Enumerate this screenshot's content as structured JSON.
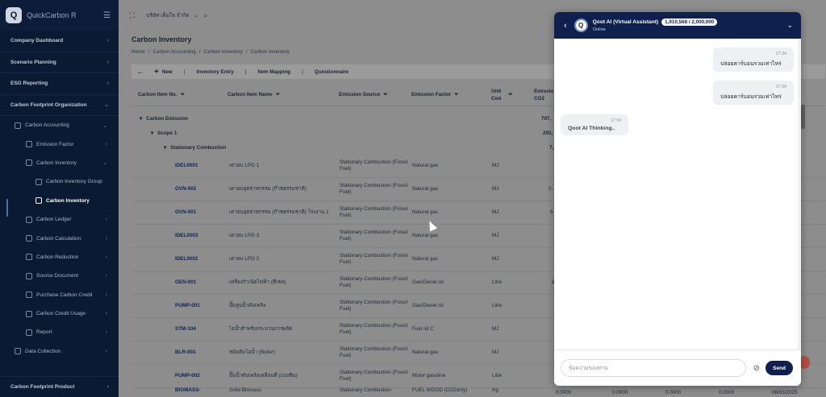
{
  "sidebar": {
    "brand": "QuickCarbon R",
    "logo_letter": "Q",
    "items": [
      {
        "label": "Company Dashboard"
      },
      {
        "label": "Scenario Planning"
      },
      {
        "label": "ESG Reporting"
      },
      {
        "label": "Carbon Footprint Organization"
      }
    ],
    "sub_items": [
      {
        "label": "Carbon Accounting"
      },
      {
        "label": "Emission Factor"
      },
      {
        "label": "Carbon Inventory"
      },
      {
        "label": "Carbon Inventory Group"
      },
      {
        "label": "Carbon Inventory"
      },
      {
        "label": "Carbon Ledger"
      },
      {
        "label": "Carbon Calculation"
      },
      {
        "label": "Carbon Reduction"
      },
      {
        "label": "Source Document"
      },
      {
        "label": "Purchase Carbon Credit"
      },
      {
        "label": "Carbon Credit Usage"
      },
      {
        "label": "Report"
      },
      {
        "label": "Data Collection"
      }
    ],
    "bottom_item": "Carbon Footprint Product"
  },
  "topbar": {
    "company": "บริษัท เต็มใจ จำกัด"
  },
  "page": {
    "title": "Carbon Inventory",
    "breadcrumb": [
      "Home",
      "/",
      "Carbon Accounting",
      "/",
      "Carbon Inventory",
      "/",
      "Carbon Inventory"
    ]
  },
  "toolbar": {
    "new_label": "New",
    "tabs": [
      "Inventory Entry",
      "Item Mapping",
      "Questionnaire"
    ]
  },
  "table": {
    "columns": [
      "Carbon Item No.",
      "Carbon Item Name",
      "Emission Source",
      "Emission Factor",
      "Unit",
      "Cod",
      "Emissio",
      "CO2"
    ],
    "groups": [
      {
        "label": "Carbon Emission",
        "value": "707,"
      },
      {
        "label": "Scope 1",
        "value": "255,"
      },
      {
        "label": "Stationary Combustion",
        "value": "7,"
      }
    ],
    "rows": [
      {
        "code": "IDEL0001",
        "name": "เตาอบ LPG 1",
        "source": "Stationary Combustion (Fossil Fuel)",
        "factor": "Natural gas",
        "unit": "MJ",
        "emission": ""
      },
      {
        "code": "OVN-002",
        "name": "เตาอบอุตสาหกรรม (ก๊าซธรรมชาติ)",
        "source": "Stationary Combustion (Fossil Fuel)",
        "factor": "Natural gas",
        "unit": "MJ",
        "emission": "5."
      },
      {
        "code": "OVN-001",
        "name": "เตาอบอุตสาหกรรม (ก๊าซธรรมชาติ) โรงงาน 1",
        "source": "Stationary Combustion (Fossil Fuel)",
        "factor": "Natural gas",
        "unit": "MJ",
        "emission": "6"
      },
      {
        "code": "IDEL0003",
        "name": "เตาอบ LPG 3",
        "source": "Stationary Combustion (Fossil Fuel)",
        "factor": "Natural gas",
        "unit": "MJ",
        "emission": ""
      },
      {
        "code": "IDEL0002",
        "name": "เตาอบ LPG 2",
        "source": "Stationary Combustion (Fossil Fuel)",
        "factor": "Natural gas",
        "unit": "MJ",
        "emission": ""
      },
      {
        "code": "GEN-001",
        "name": "เครื่องกำเนิดไฟฟ้า (ดีเซล)",
        "source": "Stationary Combustion (Fossil Fuel)",
        "factor": "Gas/Diesel oil",
        "unit": "Litre",
        "emission": "8"
      },
      {
        "code": "PUMP-001",
        "name": "ปั๊มสูบน้ำดับเพลิง",
        "source": "Stationary Combustion (Fossil Fuel)",
        "factor": "Gas/Diesel oil",
        "unit": "Litre",
        "emission": ""
      },
      {
        "code": "STM-104",
        "name": "ไอน้ำสำหรับกระบวนการผลิต",
        "source": "Stationary Combustion (Fossil Fuel)",
        "factor": "Fuel oil C",
        "unit": "MJ",
        "emission": ""
      },
      {
        "code": "BLR-003",
        "name": "หม้อต้มไอน้ำ (Boiler)",
        "source": "Stationary Combustion (Fossil Fuel)",
        "factor": "Natural gas",
        "unit": "MJ",
        "emission": ""
      },
      {
        "code": "PUMP-002",
        "name": "ปั๊มน้ำดับเพลิงเคลื่อนที่ (เบนซิน)",
        "source": "Stationary Combustion (Fossil Fuel)",
        "factor": "Motor gasoline",
        "unit": "Litre",
        "emission": ""
      },
      {
        "code": "BIOMASS-",
        "name": "Solid Biomass",
        "source": "Stationary Combustion",
        "factor": "FUEL WOOD (CO2only)",
        "unit": "Kg",
        "emission": ""
      }
    ],
    "bottom_values": [
      "0.0000",
      "0.0000",
      "0.0000",
      "0.0000",
      "08/03/2025"
    ]
  },
  "chat": {
    "title": "Qoot AI (Virtual Assistant)",
    "tokens": "1,910,568 / 2,000,000",
    "status": "Online",
    "messages": [
      {
        "from": "user",
        "time": "17:34",
        "text": "ปล่อยคาร์บอนรวมเท่าไหร่"
      },
      {
        "from": "user",
        "time": "17:34",
        "text": "ปล่อยคาร์บอนรวมเท่าไหร่"
      },
      {
        "from": "bot",
        "time": "17:34",
        "text": "Qoot AI Thinking.."
      }
    ],
    "input_placeholder": "ข้อความของท่าน",
    "send_label": "Send"
  },
  "colors": {
    "sidebar_bg": "#0b1a33",
    "chat_header": "#0f1f4e",
    "accent": "#0f2159"
  }
}
